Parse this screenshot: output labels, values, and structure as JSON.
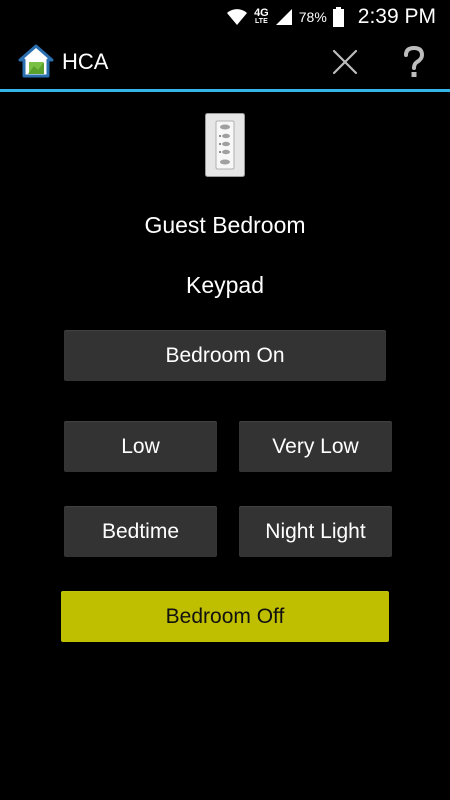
{
  "status_bar": {
    "network_label": "4G",
    "network_sub": "LTE",
    "battery_percent": "78%",
    "time": "2:39 PM"
  },
  "action_bar": {
    "title": "HCA",
    "close_icon": "close-icon",
    "help_icon": "help-icon",
    "accent_color": "#33b5e5"
  },
  "device": {
    "icon": "keypad-icon",
    "name": "Guest Bedroom",
    "type": "Keypad"
  },
  "buttons": {
    "bedroom_on": "Bedroom On",
    "low": "Low",
    "very_low": "Very Low",
    "bedtime": "Bedtime",
    "night_light": "Night Light",
    "bedroom_off": "Bedroom Off"
  },
  "colors": {
    "button_bg": "#333333",
    "off_button_bg": "#bfbf00",
    "background": "#000000"
  }
}
